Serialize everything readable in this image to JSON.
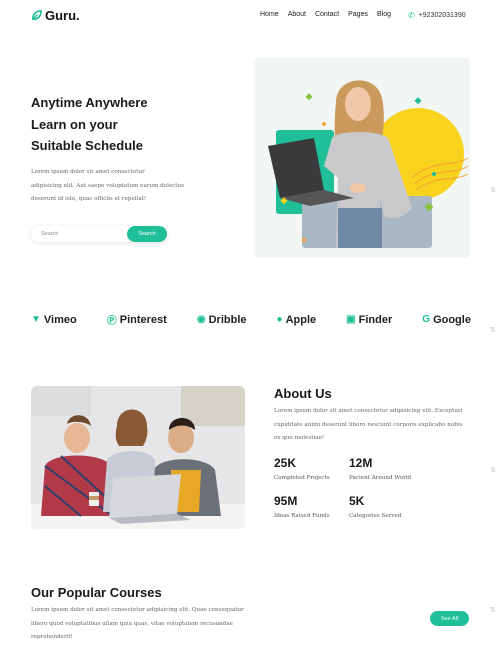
{
  "header": {
    "logo": "Guru.",
    "nav": [
      "Home",
      "About",
      "Contact",
      "Pages",
      "Blog"
    ],
    "phone": "+92302031390"
  },
  "hero": {
    "title_lines": [
      "Anytime Anywhere",
      "Learn on your",
      "Suitable Schedule"
    ],
    "desc_lines": [
      "Lorem ipsum dolor sit amet consectetur",
      "adipisicing elit. Aut saepe voluptatum earum delectus",
      "deserunt id iste, quas officiis et repellat!"
    ],
    "search_placeholder": "Search",
    "search_button": "Search"
  },
  "brands": [
    {
      "name": "Vimeo",
      "icon": "vimeo-icon"
    },
    {
      "name": "Pinterest",
      "icon": "pinterest-icon"
    },
    {
      "name": "Dribble",
      "icon": "dribbble-icon"
    },
    {
      "name": "Apple",
      "icon": "apple-icon"
    },
    {
      "name": "Finder",
      "icon": "finder-icon"
    },
    {
      "name": "Google",
      "icon": "google-icon"
    }
  ],
  "about": {
    "title": "About Us",
    "desc_lines": [
      "Lorem ipsum dolor sit amet consectetur adipisicing elit. Excepturi",
      "cupiditate animi deserunt libero nesciunt corporis explicabo nobis",
      "ex quo molestiae!"
    ],
    "stats": [
      {
        "value": "25K",
        "label": "Completed Projects"
      },
      {
        "value": "12M",
        "label": "Pacient Around World"
      },
      {
        "value": "95M",
        "label": "Ideas Raised Funds"
      },
      {
        "value": "5K",
        "label": "Categories Served"
      }
    ]
  },
  "courses": {
    "title": "Our Popular Courses",
    "desc_lines": [
      "Lorem ipsum dolor sit amet consectetur adipisicing elit. Quae consequatur",
      "libero quod voluptatibus ullam quia quas, vitae voluptatem recusandae",
      "reprehenderit!"
    ],
    "see_all": "See All"
  },
  "colors": {
    "accent": "#1fbf97",
    "yellow": "#f8d21c",
    "text": "#1a1a1a"
  }
}
